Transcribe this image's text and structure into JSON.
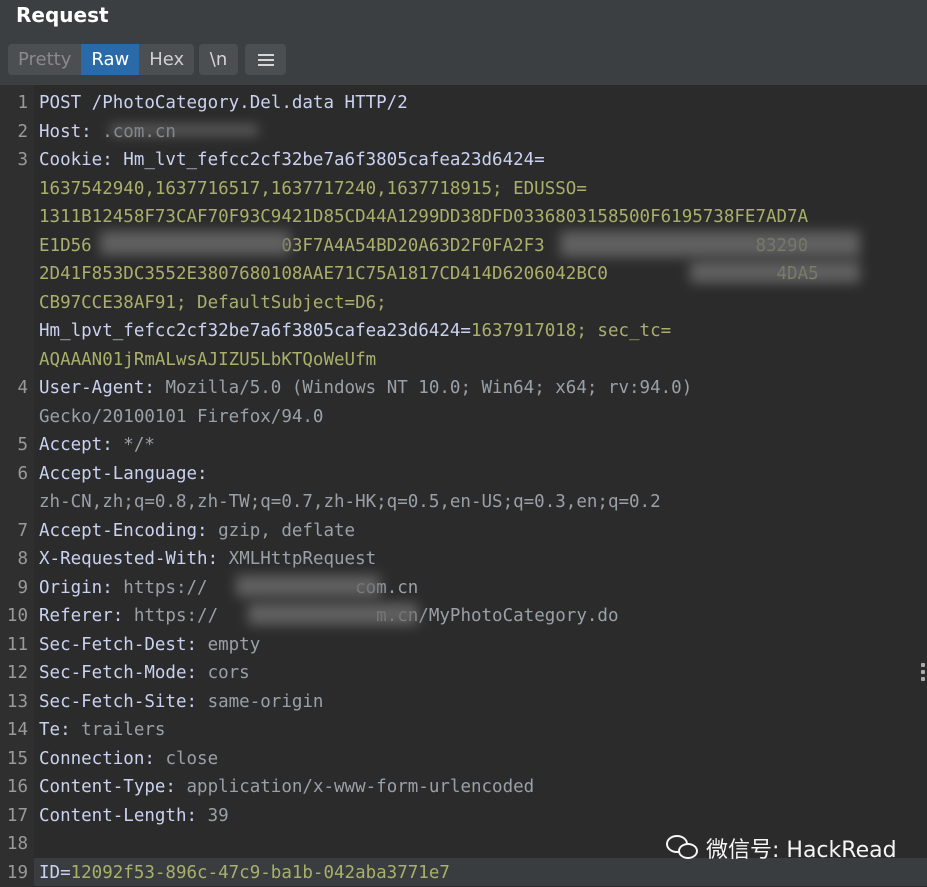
{
  "panel": {
    "title": "Request"
  },
  "toolbar": {
    "tabs": [
      {
        "label": "Pretty",
        "active": false
      },
      {
        "label": "Raw",
        "active": true
      },
      {
        "label": "Hex",
        "active": false
      }
    ],
    "newline_label": "\\n",
    "menu_icon": "hamburger-menu-icon"
  },
  "editor": {
    "lines": [
      {
        "num": "1",
        "key": "POST /PhotoCategory.Del.data HTTP/2",
        "value": ""
      },
      {
        "num": "2",
        "key": "Host: ",
        "value": ".com.cn"
      },
      {
        "num": "3",
        "key": "Cookie: Hm_lvt_fefcc2cf32be7a6f3805cafea23d6424=",
        "value": ""
      },
      {
        "num": "",
        "key": "",
        "value": "1637542940,1637716517,1637717240,1637718915; EDUSSO="
      },
      {
        "num": "",
        "key": "",
        "value": "1311B12458F73CAF70F93C9421D85CD44A1299DD38DFD0336803158500F6195738FE7AD7A"
      },
      {
        "num": "",
        "key": "",
        "value": "E1D56                  03F7A4A54BD20A63D2F0FA2F3                    83290"
      },
      {
        "num": "",
        "key": "",
        "value": "2D41F853DC3552E3807680108AAE71C75A1817CD414D6206042BC0                4DA5"
      },
      {
        "num": "",
        "key": "",
        "value": "CB97CCE38AF91; DefaultSubject=D6;"
      },
      {
        "num": "",
        "key": "Hm_lpvt_fefcc2cf32be7a6f3805cafea23d6424=",
        "value": "1637917018; sec_tc="
      },
      {
        "num": "",
        "key": "",
        "value": "AQAAAN01jRmALwsAJIZU5LbKTQoWeUfm"
      },
      {
        "num": "4",
        "key": "User-Agent: ",
        "value": "Mozilla/5.0 (Windows NT 10.0; Win64; x64; rv:94.0)"
      },
      {
        "num": "",
        "key": "",
        "value": "Gecko/20100101 Firefox/94.0"
      },
      {
        "num": "5",
        "key": "Accept: ",
        "value": "*/*"
      },
      {
        "num": "6",
        "key": "Accept-Language:",
        "value": ""
      },
      {
        "num": "",
        "key": "",
        "value": "zh-CN,zh;q=0.8,zh-TW;q=0.7,zh-HK;q=0.5,en-US;q=0.3,en;q=0.2"
      },
      {
        "num": "7",
        "key": "Accept-Encoding: ",
        "value": "gzip, deflate"
      },
      {
        "num": "8",
        "key": "X-Requested-With: ",
        "value": "XMLHttpRequest"
      },
      {
        "num": "9",
        "key": "Origin: ",
        "value": "https://              com.cn"
      },
      {
        "num": "10",
        "key": "Referer: ",
        "value": "https://               m.cn/MyPhotoCategory.do"
      },
      {
        "num": "11",
        "key": "Sec-Fetch-Dest: ",
        "value": "empty"
      },
      {
        "num": "12",
        "key": "Sec-Fetch-Mode: ",
        "value": "cors"
      },
      {
        "num": "13",
        "key": "Sec-Fetch-Site: ",
        "value": "same-origin"
      },
      {
        "num": "14",
        "key": "Te: ",
        "value": "trailers"
      },
      {
        "num": "15",
        "key": "Connection: ",
        "value": "close"
      },
      {
        "num": "16",
        "key": "Content-Type: ",
        "value": "application/x-www-form-urlencoded"
      },
      {
        "num": "17",
        "key": "Content-Length: ",
        "value": "39"
      },
      {
        "num": "18",
        "key": "",
        "value": ""
      },
      {
        "num": "19",
        "key": "ID=",
        "value": "12092f53-896c-47c9-ba1b-042aba3771e7"
      }
    ]
  },
  "watermark": {
    "text": "微信号: HackRead",
    "icon": "wechat-icon"
  }
}
